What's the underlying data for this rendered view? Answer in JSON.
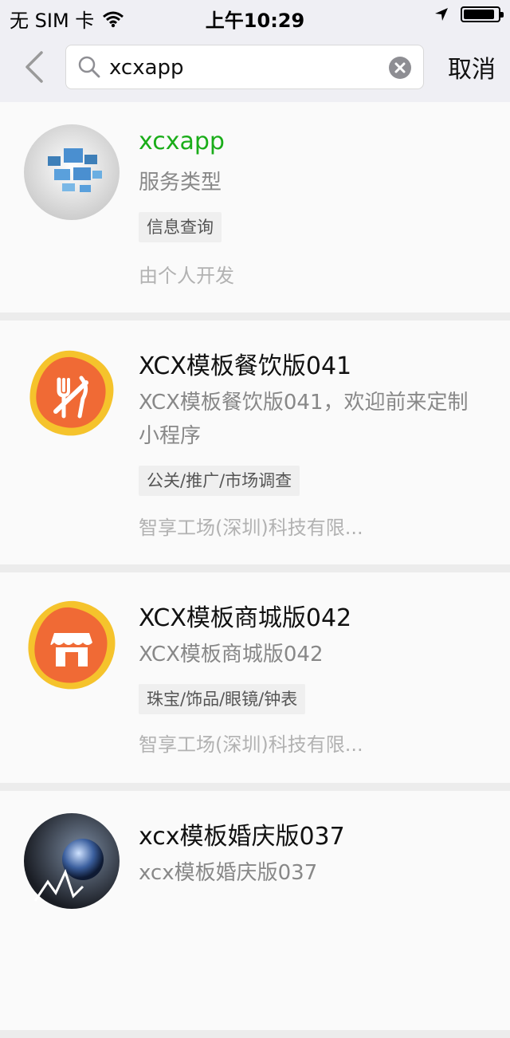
{
  "status_bar": {
    "carrier": "无 SIM 卡",
    "time": "上午10:29",
    "battery_level": 0.9
  },
  "nav": {
    "search_value": "xcxapp",
    "cancel_label": "取消"
  },
  "results": [
    {
      "name": "xcxapp",
      "description": "服务类型",
      "tag": "信息查询",
      "developer": "由个人开发",
      "avatar_icon": "computer-screens-icon"
    },
    {
      "name": "XCX模板餐饮版041",
      "description": "XCX模板餐饮版041，欢迎前来定制小程序",
      "tag": "公关/推广/市场调查",
      "developer": "智享工场(深圳)科技有限...",
      "avatar_icon": "fork-knife-icon"
    },
    {
      "name": "XCX模板商城版042",
      "description": "XCX模板商城版042",
      "tag": "珠宝/饰品/眼镜/钟表",
      "developer": "智享工场(深圳)科技有限...",
      "avatar_icon": "storefront-icon"
    },
    {
      "name": "xcx模板婚庆版037",
      "description": "xcx模板婚庆版037",
      "tag": "",
      "developer": "",
      "avatar_icon": "globe-icon"
    }
  ],
  "colors": {
    "highlight_green": "#1aad19",
    "accent_orange": "#f06a35",
    "accent_yellow": "#f5c32c"
  }
}
